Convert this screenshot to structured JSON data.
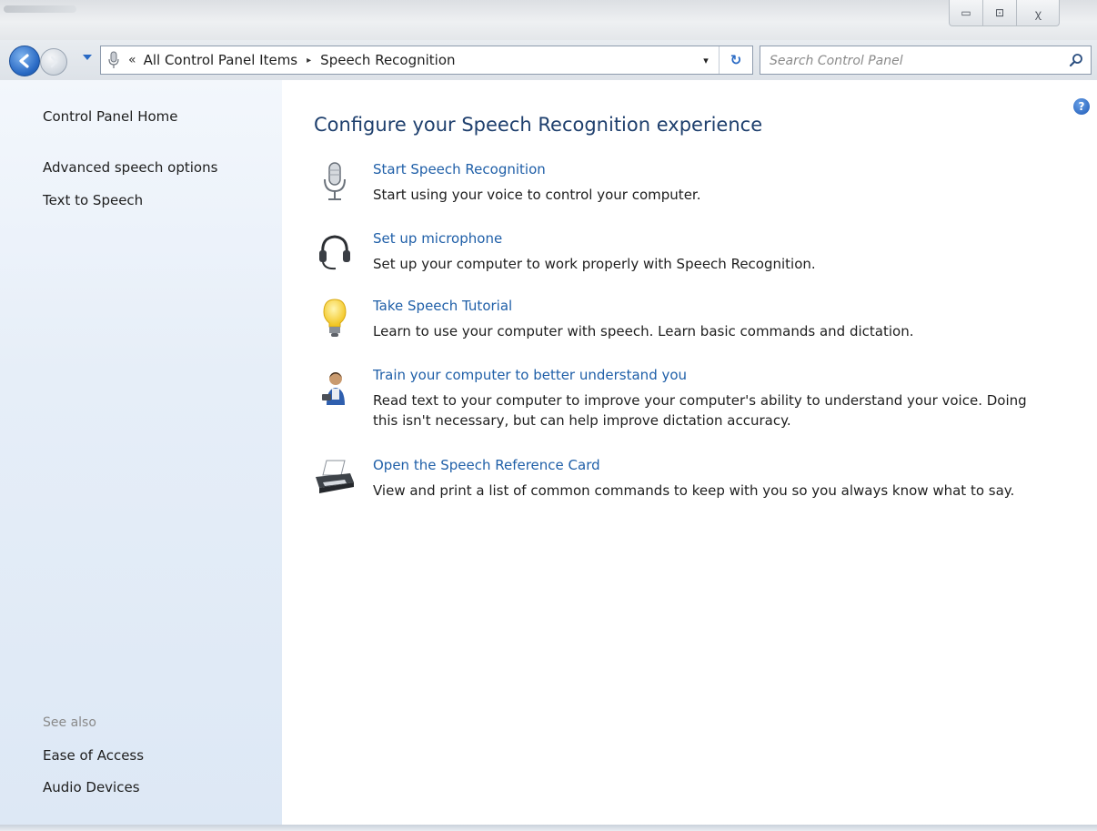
{
  "window": {
    "controls": {
      "minimize": "▭",
      "maximize": "⊡",
      "close": "ꭓ"
    }
  },
  "address_bar": {
    "overflow": "«",
    "breadcrumbs": [
      "All Control Panel Items",
      "Speech Recognition"
    ],
    "separator": "▸",
    "dropdown": "▾",
    "refresh": "↻"
  },
  "search": {
    "placeholder": "Search Control Panel"
  },
  "sidebar": {
    "home": "Control Panel Home",
    "links": [
      "Advanced speech options",
      "Text to Speech"
    ],
    "see_also_heading": "See also",
    "see_also": [
      "Ease of Access",
      "Audio Devices"
    ]
  },
  "main": {
    "help": "?",
    "title": "Configure your Speech Recognition experience",
    "tasks": [
      {
        "icon": "microphone-icon",
        "link": "Start Speech Recognition",
        "desc": "Start using your voice to control your computer."
      },
      {
        "icon": "headset-icon",
        "link": "Set up microphone",
        "desc": "Set up your computer to work properly with Speech Recognition."
      },
      {
        "icon": "lightbulb-icon",
        "link": "Take Speech Tutorial",
        "desc": "Learn to use your computer with speech.  Learn basic commands and dictation."
      },
      {
        "icon": "user-training-icon",
        "link": "Train your computer to better understand you",
        "desc": "Read text to your computer to improve your computer's ability to understand your voice. Doing this isn't necessary, but can help improve dictation accuracy."
      },
      {
        "icon": "printer-icon",
        "link": "Open the Speech Reference Card",
        "desc": "View and print a list of common commands to keep with you so you always know what to say."
      }
    ]
  },
  "colors": {
    "link": "#1f5fa8",
    "title": "#1e3f6d",
    "sidebar_bg": "#e6eef8",
    "text": "#1e1e1e"
  }
}
